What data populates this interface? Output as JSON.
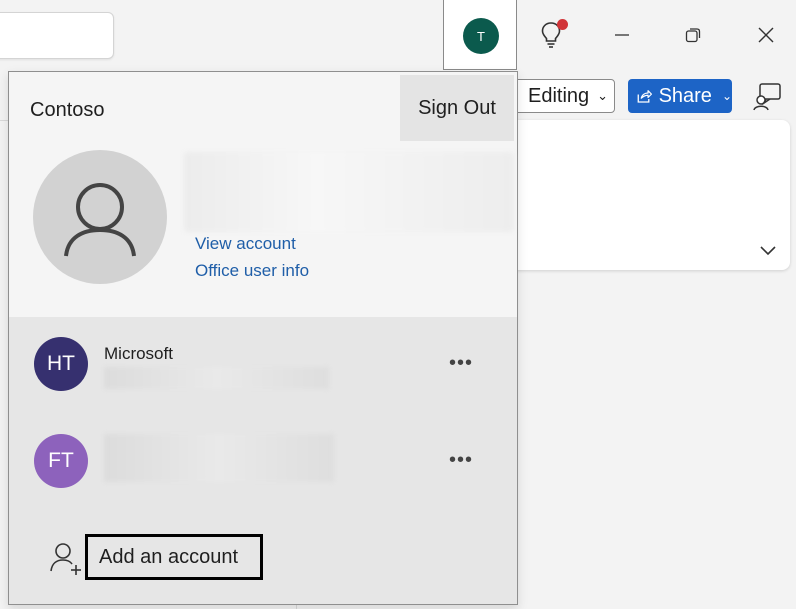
{
  "account_button": {
    "initial": "T",
    "avatar_color": "#0b5a4d"
  },
  "window": {
    "notification_dot_color": "#d13438"
  },
  "ribbon": {
    "editing_label": "Editing",
    "share_label": "Share",
    "share_color": "#1d64c6"
  },
  "flyout": {
    "org_name": "Contoso",
    "sign_out_label": "Sign Out",
    "links": {
      "view_account": "View account",
      "office_user_info": "Office user info"
    },
    "accounts": [
      {
        "initials": "HT",
        "name": "Microsoft",
        "color": "#36306f"
      },
      {
        "initials": "FT",
        "name": "",
        "color": "#8d62bc"
      }
    ],
    "add_account_label": "Add an account"
  }
}
